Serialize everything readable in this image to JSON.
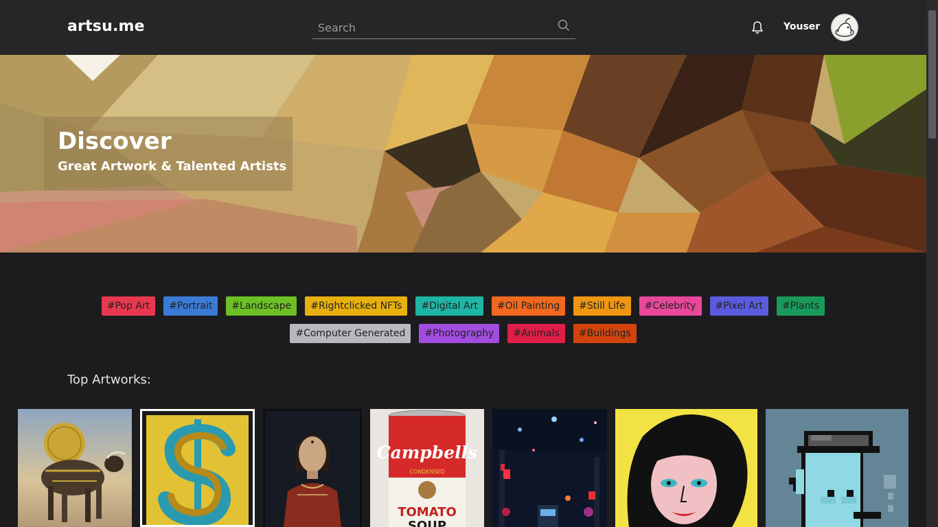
{
  "header": {
    "logo": "artsu.me",
    "search_placeholder": "Search",
    "username": "Youser",
    "icons": [
      "search-icon",
      "bell-icon",
      "avatar-icon"
    ]
  },
  "hero": {
    "title": "Discover",
    "subtitle": "Great Artwork & Talented Artists"
  },
  "tags": [
    {
      "label": "#Pop Art",
      "color": "#e8384f"
    },
    {
      "label": "#Portrait",
      "color": "#3a7bd5"
    },
    {
      "label": "#Landscape",
      "color": "#6cc024"
    },
    {
      "label": "#Rightclicked NFTs",
      "color": "#e8b00f"
    },
    {
      "label": "#Digital Art",
      "color": "#1fb5a4"
    },
    {
      "label": "#Oil Painting",
      "color": "#f0691e"
    },
    {
      "label": "#Still Life",
      "color": "#f09613"
    },
    {
      "label": "#Celebrity",
      "color": "#e8479a"
    },
    {
      "label": "#Pixel Art",
      "color": "#5b5be0"
    },
    {
      "label": "#Plants",
      "color": "#1a9a5a"
    },
    {
      "label": "#Computer Generated",
      "color": "#b9b9bd"
    },
    {
      "label": "#Photography",
      "color": "#a24de0"
    },
    {
      "label": "#Animals",
      "color": "#e01e48"
    },
    {
      "label": "#Buildings",
      "color": "#d2440c"
    }
  ],
  "section": {
    "title": "Top Artworks:"
  },
  "artworks": [
    {
      "subject": "golden bull with coin",
      "selected": false
    },
    {
      "subject": "dollar sign pop art",
      "selected": true
    },
    {
      "subject": "renaissance portrait",
      "selected": false
    },
    {
      "subject": "soup can",
      "selected": false,
      "text": [
        "Campbells",
        "CONDENSED",
        "TOMATO",
        "SOUP"
      ]
    },
    {
      "subject": "city street at night",
      "selected": false
    },
    {
      "subject": "celebrity pop portrait",
      "selected": false
    },
    {
      "subject": "pixel art character",
      "selected": false
    }
  ]
}
